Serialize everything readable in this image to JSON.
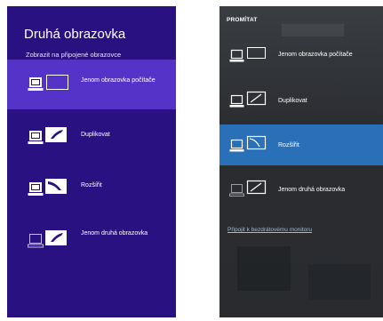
{
  "left_panel": {
    "title": "Druhá obrazovka",
    "subtitle": "Zobrazit na připojené obrazovce",
    "options": [
      {
        "label": "Jenom obrazovka počítače",
        "icon": "pc-screen-only-icon",
        "selected": true
      },
      {
        "label": "Duplikovat",
        "icon": "duplicate-icon",
        "selected": false
      },
      {
        "label": "Rozšířit",
        "icon": "extend-icon",
        "selected": false
      },
      {
        "label": "Jenom druhá obrazovka",
        "icon": "second-screen-only-icon",
        "selected": false
      }
    ],
    "colors": {
      "background": "#2a1181",
      "selected": "#5434c8"
    }
  },
  "right_panel": {
    "header": "PROMÍTAT",
    "options": [
      {
        "label": "Jenom obrazovka počítače",
        "icon": "pc-screen-only-icon",
        "selected": false
      },
      {
        "label": "Duplikovat",
        "icon": "duplicate-icon",
        "selected": false
      },
      {
        "label": "Rozšířit",
        "icon": "extend-icon",
        "selected": true
      },
      {
        "label": "Jenom druhá obrazovka",
        "icon": "second-screen-only-icon",
        "selected": false
      }
    ],
    "link": "Připojit k bezdrátovému monitoru",
    "colors": {
      "background": "#2b2d31",
      "selected": "#2a70b8",
      "link": "#9fb9d8"
    }
  }
}
